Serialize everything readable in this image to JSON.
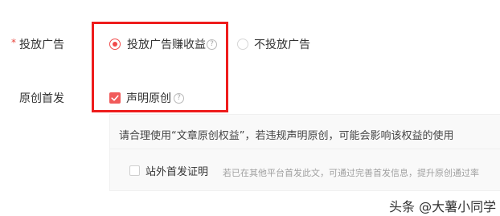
{
  "settings": {
    "ad": {
      "required_mark": "*",
      "label": "投放广告",
      "options": [
        {
          "label": "投放广告赚收益",
          "selected": true
        },
        {
          "label": "不投放广告",
          "selected": false
        }
      ]
    },
    "original": {
      "label": "原创首发",
      "checkbox_label": "声明原创",
      "checked": true
    },
    "notice": {
      "text": "请合理使用“文章原创权益”，若违规声明原创，可能会影响该权益的使用",
      "offsite_label": "站外首发证明",
      "offsite_checked": false,
      "offsite_hint": "若已在其他平台首发此文，可通过完善首发信息，提升原创通过率"
    }
  },
  "watermark": "头条 @大薯小同学",
  "colors": {
    "accent": "#f04a4a",
    "highlight_box": "#ee1c1c"
  }
}
